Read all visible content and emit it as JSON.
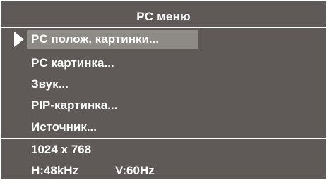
{
  "menu": {
    "title": "PC меню",
    "items": [
      {
        "label": "PC полож. картинки...",
        "selected": true
      },
      {
        "label": "PC картинка...",
        "selected": false
      },
      {
        "label": "Звук...",
        "selected": false
      },
      {
        "label": "PIP-картинка...",
        "selected": false
      },
      {
        "label": "Источник...",
        "selected": false
      }
    ]
  },
  "status": {
    "resolution": "1024 x 768",
    "h_freq": "H:48kHz",
    "v_freq": "V:60Hz"
  },
  "colors": {
    "panel": "#5f5a58",
    "highlight": "#8e8a86",
    "text": "#ffffff"
  },
  "icons": {
    "pointer": "triangle-right-icon"
  }
}
